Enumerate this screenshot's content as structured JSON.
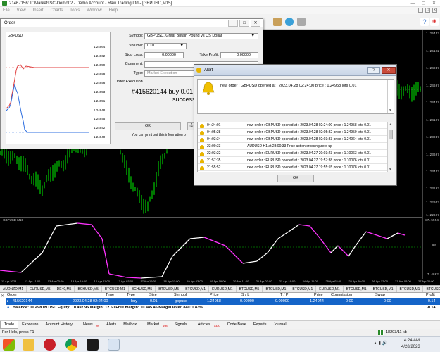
{
  "window": {
    "title": "21467156: ICMarketsSC-Demo02 - Demo Account - Raw Trading Ltd - [GBPUSD,M15]"
  },
  "menu": [
    "File",
    "View",
    "Insert",
    "Charts",
    "Tools",
    "Window",
    "Help"
  ],
  "price_scale": [
    "1.25442",
    "1.25192",
    "1.24947",
    "1.24697",
    "1.24447",
    "1.24197",
    "1.23947",
    "1.23697",
    "1.23442",
    "1.23192",
    "1.22942",
    "1.22697",
    "1.22447",
    "1.21697",
    "1.20947"
  ],
  "indicator": {
    "title": "GBPUSD M15",
    "levels": [
      "87.5554",
      "50",
      "7.4862"
    ]
  },
  "time_axis": [
    "11 Apr 2023",
    "12 Apr 11:00",
    "13 Apr 03:00",
    "13 Apr 19:00",
    "14 Apr 11:00",
    "17 Apr 03:00",
    "17 Apr 19:00",
    "18 Apr 11:00",
    "19 Apr 03:00",
    "19 Apr 19:00",
    "20 Apr 11:00",
    "21 Apr 03:00",
    "21 Apr 19:00",
    "24 Apr 11:00",
    "25 Apr 03:00",
    "25 Apr 20:00",
    "26 Apr 12:00",
    "27 Apr 04:00",
    "27 Apr 20:00"
  ],
  "chart_tabs": [
    "AUDNZD,M1",
    "EURUSD,M5",
    "DE40,M5",
    "BCHUSD,M5",
    "BTCUSD,M1",
    "BCHUSD,M5",
    "BTCUSD,M5",
    "BTCUSD,M1",
    "EURUSD,M1",
    "BTCUSD,M5",
    "BTCUSD,M1",
    "BTCUSD,M1",
    "EURUSD,M1",
    "BTCUSD,M1",
    "BTCUSD,M1",
    "BTCUSD,M1",
    "BTCUSD,M1",
    "BTCUSD,M1",
    "BTCUSD,M1",
    "BTC"
  ],
  "order_dialog": {
    "title": "Order",
    "mini_symbol": "GBPUSD",
    "mini_prices": [
      "1.24964",
      "1.24962",
      "1.24959",
      "1.24958",
      "1.24956",
      "1.24953",
      "1.24951",
      "1.24948",
      "1.24945",
      "1.24942",
      "1.24940"
    ],
    "symbol_label": "Symbol:",
    "symbol_value": "GBPUSD, Great Britain Pound vs US Dollar",
    "volume_label": "Volume:",
    "volume_value": "0.01",
    "stoploss_label": "Stop Loss:",
    "stoploss_value": "0.00000",
    "takeprofit_label": "Take Profit:",
    "takeprofit_value": "0.00000",
    "comment_label": "Comment:",
    "comment_value": "",
    "type_label": "Type:",
    "type_value": "Market Execution",
    "execution_heading": "Order Execution",
    "result_line1": "#415620144 buy 0.01 G",
    "result_line2": "success",
    "ok_label": "OK",
    "print_hint": "You can print out this information b"
  },
  "alert_dialog": {
    "title": "Alert",
    "message": "new order : GBPUSD opened at : 2023.04.28 02:24:00 price : 1.24958 lots 0.01",
    "rows": [
      {
        "time": "04:24:01",
        "text": "new order : GBPUSD opened at : 2023.04.28 02:24:00 price : 1.24958 lots 0.01"
      },
      {
        "time": "04:05:28",
        "text": "new order : GBPUSD opened at : 2023.04.28 02:05:32 price : 1.24959 lots 0.01"
      },
      {
        "time": "04:03:34",
        "text": "new order : GBPUSD opened at : 2023.04.28 02:03:33 price : 1.24964 lots 0.01"
      },
      {
        "time": "23:00:33",
        "text": "AUDUSD H1 at 23:00:33 Price action  crossing zero up"
      },
      {
        "time": "22:03:22",
        "text": "new order : EURUSD opened at : 2023.04.27 20:03:23 price : 1.10063 lots 0.01"
      },
      {
        "time": "21:57:35",
        "text": "new order : EURUSD opened at : 2023.04.27 19:57:38 price : 1.10076 lots 0.01"
      },
      {
        "time": "21:55:52",
        "text": "new order : EURUSD opened at : 2023.04.27 19:55:55 price : 1.10078 lots 0.01"
      }
    ],
    "ok_label": "OK"
  },
  "terminal": {
    "headers": {
      "order": "Order",
      "time": "Time",
      "type": "Type",
      "size": "Size",
      "symbol": "Symbol",
      "price": "Price",
      "sl": "S / L",
      "tp": "T / P",
      "price2": "Price",
      "commission": "Commission",
      "swap": "Swap",
      "profit": "Profit"
    },
    "row": {
      "order": "415620144",
      "time": "2023.04.28 02:24:00",
      "type": "buy",
      "size": "0.01",
      "symbol": "gbpusd",
      "price": "1.24958",
      "sl": "0.00000",
      "tp": "0.00000",
      "price2": "1.24944",
      "commission": "0.00",
      "swap": "0.00",
      "profit": "-0.14"
    },
    "balance": "Balance: 10 498.09 USD  Equity: 10 497.95  Margin: 12.50  Free margin: 10 485.45  Margin level: 84011.83%",
    "balance_profit": "-0.14",
    "tabs": [
      "Trade",
      "Exposure",
      "Account History",
      "News",
      "Alerts",
      "Mailbox",
      "Market",
      "Signals",
      "Articles",
      "Code Base",
      "Experts",
      "Journal"
    ],
    "tab_badges": {
      "news": "99",
      "market": "198",
      "articles": "1320"
    }
  },
  "status": {
    "help": "For Help, press F1",
    "traffic": "18203/11 kb"
  },
  "taskbar": {
    "time": "4:24 AM",
    "date": "4/28/2023"
  },
  "colors": {
    "candle_bull": "#00c800",
    "candle_bear": "#00c800",
    "indicator_up": "#ffffff",
    "indicator_down": "#ff33ff",
    "level_line": "#00c800",
    "selected_row": "#1464c8"
  }
}
